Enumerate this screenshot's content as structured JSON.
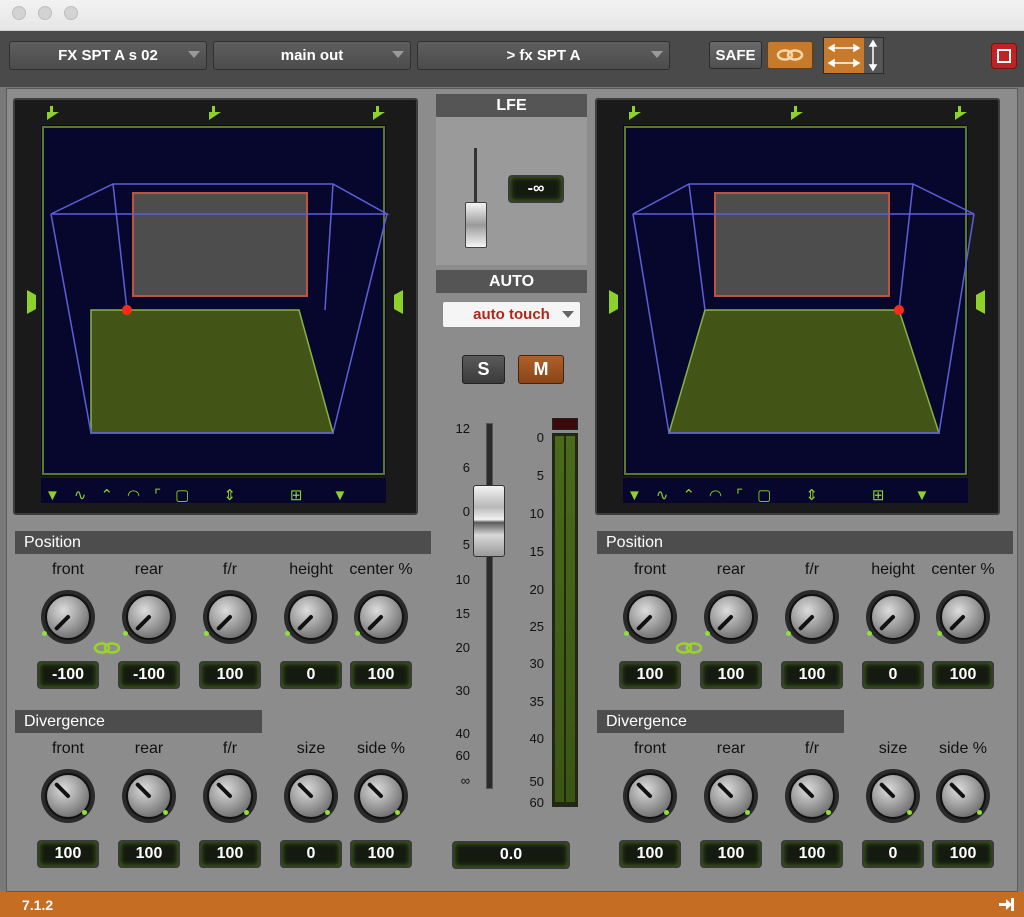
{
  "window": {
    "traffic_lights": [
      "close",
      "minimize",
      "zoom"
    ]
  },
  "toolbar": {
    "track_name": "FX SPT A s 02",
    "output": "main out",
    "send": "> fx SPT A",
    "safe_label": "SAFE",
    "accent_color": "#c67a2c",
    "close_color": "#bf2323"
  },
  "lfe": {
    "label": "LFE",
    "value": "-∞"
  },
  "auto": {
    "label": "AUTO",
    "mode": "auto touch",
    "solo_label": "S",
    "mute_label": "M"
  },
  "fader": {
    "scale": [
      "12",
      "6",
      "0",
      "5",
      "10",
      "15",
      "20",
      "30",
      "40",
      "60",
      "∞"
    ],
    "meter_scale": [
      "0",
      "5",
      "10",
      "15",
      "20",
      "25",
      "30",
      "35",
      "40",
      "50",
      "60"
    ],
    "value": "0.0"
  },
  "left": {
    "position_title": "Position",
    "divergence_title": "Divergence",
    "position": [
      {
        "label": "front",
        "value": "-100"
      },
      {
        "label": "rear",
        "value": "-100"
      },
      {
        "label": "f/r",
        "value": "100"
      },
      {
        "label": "height",
        "value": "0"
      },
      {
        "label": "center %",
        "value": "100"
      }
    ],
    "divergence": [
      {
        "label": "front",
        "value": "100"
      },
      {
        "label": "rear",
        "value": "100"
      },
      {
        "label": "f/r",
        "value": "100"
      },
      {
        "label": "size",
        "value": "0"
      },
      {
        "label": "side %",
        "value": "100"
      }
    ]
  },
  "right": {
    "position_title": "Position",
    "divergence_title": "Divergence",
    "position": [
      {
        "label": "front",
        "value": "100"
      },
      {
        "label": "rear",
        "value": "100"
      },
      {
        "label": "f/r",
        "value": "100"
      },
      {
        "label": "height",
        "value": "0"
      },
      {
        "label": "center %",
        "value": "100"
      }
    ],
    "divergence": [
      {
        "label": "front",
        "value": "100"
      },
      {
        "label": "rear",
        "value": "100"
      },
      {
        "label": "f/r",
        "value": "100"
      },
      {
        "label": "size",
        "value": "0"
      },
      {
        "label": "side %",
        "value": "100"
      }
    ]
  },
  "footer": {
    "format": "7.1.2"
  },
  "panner_tools": [
    "speaker-icon",
    "path-icon",
    "arc-up-icon",
    "arc-icon",
    "arc-corner-icon",
    "box-icon",
    "height-arrows-icon",
    "grid-icon",
    "speaker-icon"
  ]
}
